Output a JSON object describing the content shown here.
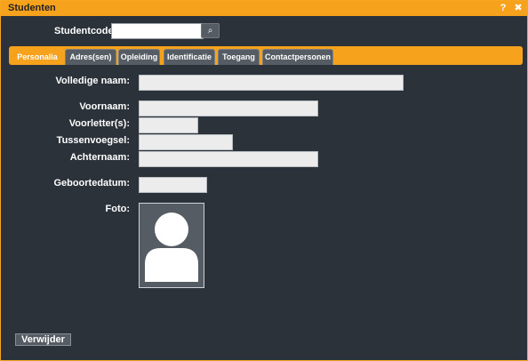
{
  "window": {
    "title": "Studenten",
    "help_label": "?",
    "close_label": "✖"
  },
  "studentcode": {
    "label": "Studentcode:",
    "value": "",
    "search_icon": "⌕"
  },
  "tabs": [
    {
      "label": "Personalia",
      "active": true
    },
    {
      "label": "Adres(sen)",
      "active": false
    },
    {
      "label": "Opleiding",
      "active": false
    },
    {
      "label": "Identificatie",
      "active": false
    },
    {
      "label": "Toegang",
      "active": false
    },
    {
      "label": "Contactpersonen",
      "active": false
    }
  ],
  "form": {
    "volledige_naam": {
      "label": "Volledige naam:",
      "value": ""
    },
    "voornaam": {
      "label": "Voornaam:",
      "value": ""
    },
    "voorletters": {
      "label": "Voorletter(s):",
      "value": ""
    },
    "tussenvoegsel": {
      "label": "Tussenvoegsel:",
      "value": ""
    },
    "achternaam": {
      "label": "Achternaam:",
      "value": ""
    },
    "geboortedatum": {
      "label": "Geboortedatum:",
      "value": ""
    },
    "foto": {
      "label": "Foto:",
      "icon": "person-silhouette-icon"
    }
  },
  "actions": {
    "delete_label": "Verwijder"
  },
  "colors": {
    "accent": "#f6a21d",
    "background": "#2b323a",
    "tab_inactive": "#555c63"
  }
}
